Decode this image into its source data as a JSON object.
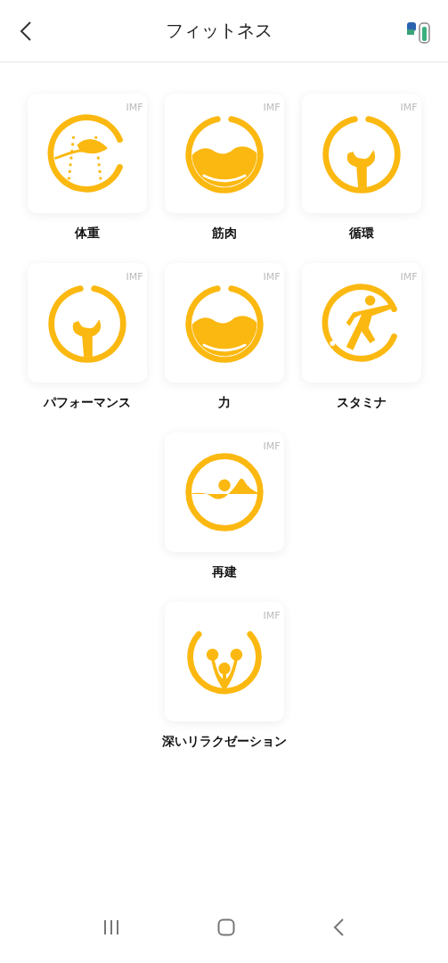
{
  "header": {
    "title": "フィットネス"
  },
  "programs": [
    {
      "label": "体重",
      "badge": "IMF",
      "kind": "feather"
    },
    {
      "label": "筋肉",
      "badge": "IMF",
      "kind": "bowl"
    },
    {
      "label": "循環",
      "badge": "IMF",
      "kind": "wrench"
    },
    {
      "label": "パフォーマンス",
      "badge": "IMF",
      "kind": "wrench"
    },
    {
      "label": "力",
      "badge": "IMF",
      "kind": "bowl"
    },
    {
      "label": "スタミナ",
      "badge": "IMF",
      "kind": "runner"
    },
    {
      "label": "再建",
      "badge": "IMF",
      "kind": "person"
    },
    {
      "label": "深いリラクゼーション",
      "badge": "IMF",
      "kind": "drops"
    }
  ]
}
